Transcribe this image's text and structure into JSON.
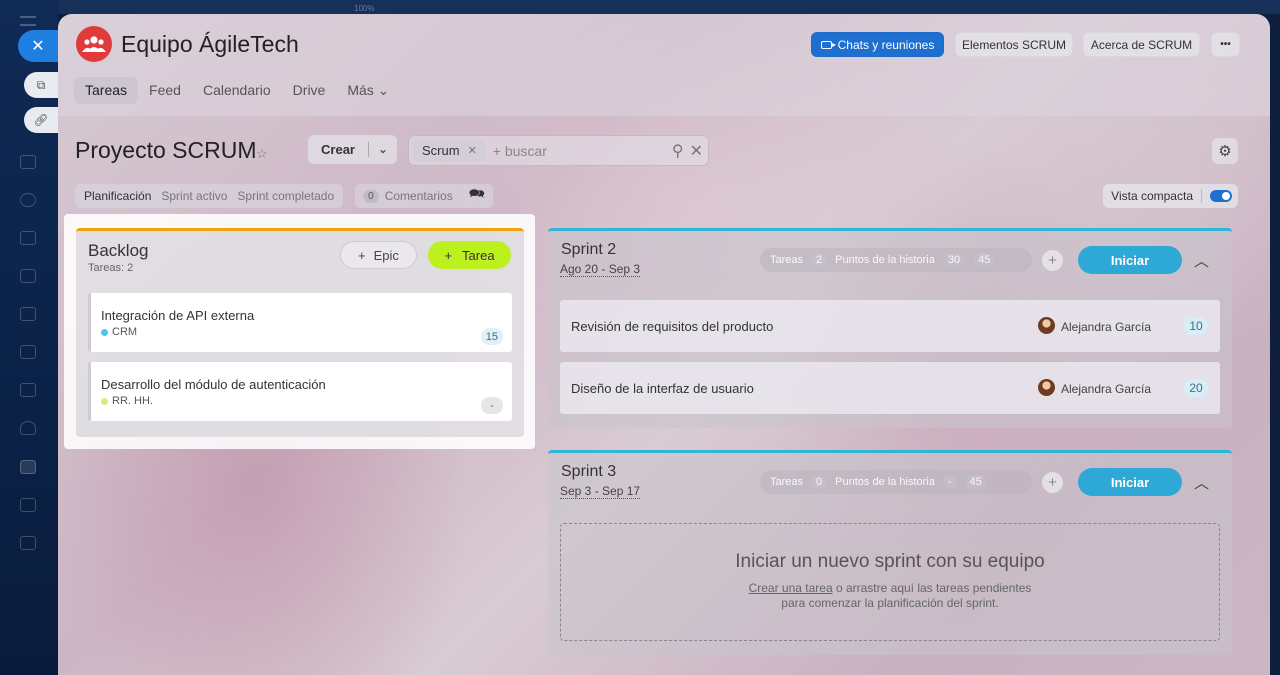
{
  "app": {
    "team_name": "Equipo ÁgileTech",
    "close_icon": "close-icon",
    "topstrip_pct": "100%"
  },
  "header": {
    "chats_label": "Chats y reuniones",
    "elements_label": "Elementos SCRUM",
    "about_label": "Acerca de SCRUM",
    "more_label": "•••"
  },
  "tabs": [
    {
      "label": "Tareas",
      "active": true
    },
    {
      "label": "Feed",
      "active": false
    },
    {
      "label": "Calendario",
      "active": false
    },
    {
      "label": "Drive",
      "active": false
    },
    {
      "label": "Más ⌄",
      "active": false
    }
  ],
  "project": {
    "title": "Proyecto SCRUM",
    "create_label": "Crear",
    "search_chip": "Scrum",
    "search_placeholder": "+ buscar"
  },
  "modes": {
    "items": [
      {
        "label": "Planificación",
        "active": true
      },
      {
        "label": "Sprint activo",
        "active": false
      },
      {
        "label": "Sprint completado",
        "active": false
      }
    ],
    "comments_count": "0",
    "comments_label": "Comentarios",
    "compact_label": "Vista compacta",
    "compact_on": true
  },
  "backlog": {
    "title": "Backlog",
    "count_label": "Tareas: 2",
    "epic_label": "Epic",
    "task_label": "Tarea",
    "tasks": [
      {
        "name": "Integración de API externa",
        "tag": "CRM",
        "tag_color": "#4ec7e8",
        "points": "15",
        "pts_bg": "#dff1f7",
        "pts_color": "#3b6f82"
      },
      {
        "name": "Desarrollo del módulo de autenticación",
        "tag": "RR. HH.",
        "tag_color": "#d7ec7a",
        "points": "-",
        "pts_bg": "#e6e6e8",
        "pts_color": "#666"
      }
    ]
  },
  "sprints": [
    {
      "name": "Sprint 2",
      "dates": "Ago 20 - Sep 3",
      "tasks_label": "Tareas",
      "tasks_count": "2",
      "points_label": "Puntos de la historia",
      "points_done": "30",
      "points_total": "45",
      "start_label": "Iniciar",
      "tasks": [
        {
          "name": "Revisión de requisitos del producto",
          "user": "Alejandra García",
          "points": "10"
        },
        {
          "name": "Diseño de la interfaz de usuario",
          "user": "Alejandra García",
          "points": "20"
        }
      ]
    },
    {
      "name": "Sprint 3",
      "dates": "Sep 3 - Sep 17",
      "tasks_label": "Tareas",
      "tasks_count": "0",
      "points_label": "Puntos de la historia",
      "points_done": "-",
      "points_total": "45",
      "start_label": "Iniciar",
      "empty_title": "Iniciar un nuevo sprint con su equipo",
      "empty_link": "Crear una tarea",
      "empty_text_1": " o arrastre aquí las tareas pendientes",
      "empty_text_2": "para comenzar la planificación del sprint."
    }
  ],
  "colors": {
    "accent_blue": "#1f6fd1",
    "backlog_border": "#f2a20c",
    "sprint_border": "#2fb6d6",
    "task_button": "#bdf01f",
    "start_button": "#2ea8d6"
  }
}
